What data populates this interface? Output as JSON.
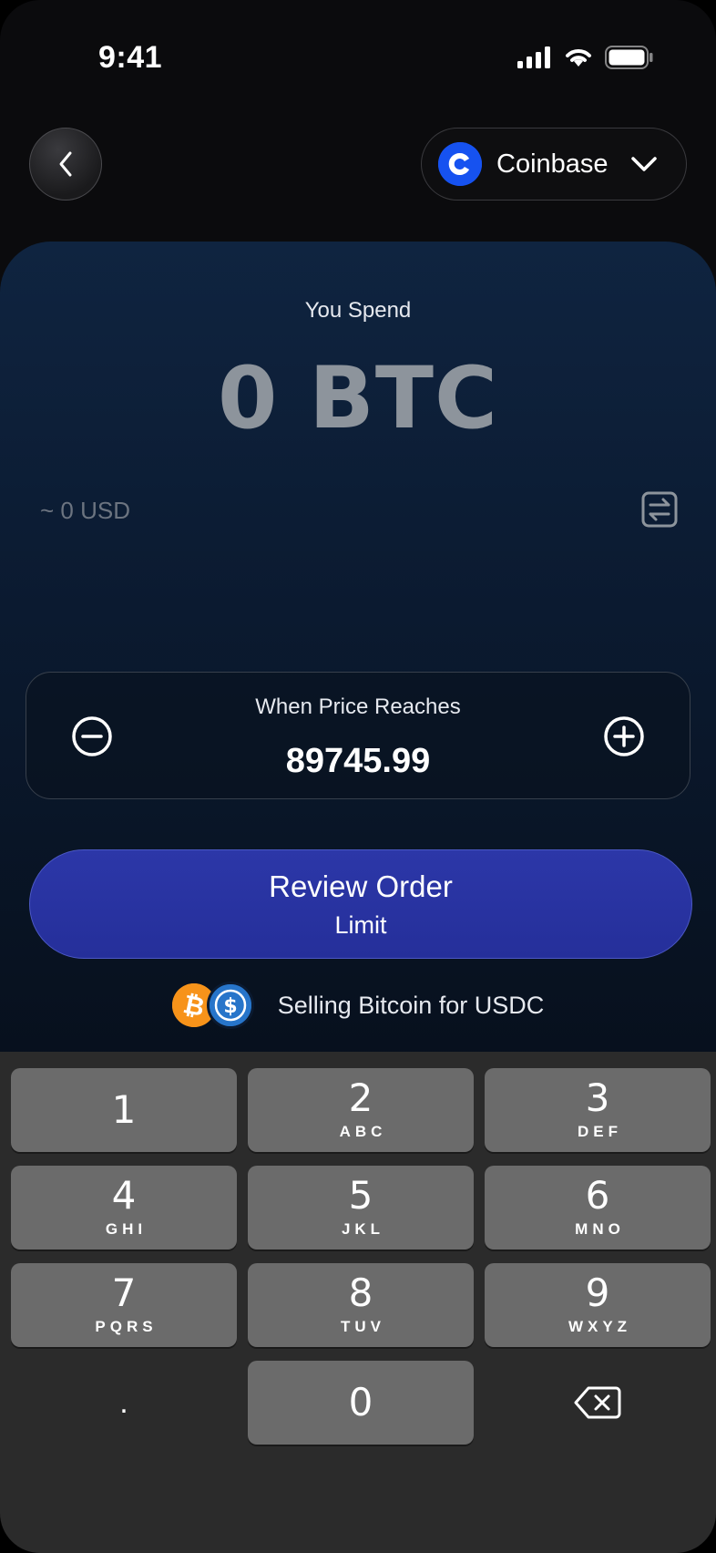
{
  "status_bar": {
    "time": "9:41"
  },
  "header": {
    "exchange": "Coinbase"
  },
  "order": {
    "spend_label": "You Spend",
    "spend_amount": "0 BTC",
    "usd_approx": "~ 0 USD",
    "price_label": "When Price Reaches",
    "price_value": "89745.99",
    "review_title": "Review Order",
    "review_subtitle": "Limit",
    "pair_text": "Selling Bitcoin for USDC"
  },
  "icons": {
    "back": "chevron-left-icon",
    "exchange_logo": "coinbase-logo",
    "dropdown": "chevron-down-icon",
    "swap": "swap-currency-icon",
    "minus": "minus-circle-icon",
    "plus": "plus-circle-icon",
    "btc": "bitcoin-icon",
    "usdc": "usdc-icon",
    "backspace": "backspace-icon"
  },
  "colors": {
    "accent": "#2c37a8",
    "coinbase_blue": "#1652f0",
    "btc_orange": "#f7931a",
    "usdc_blue": "#2775ca"
  },
  "keypad": {
    "keys": [
      {
        "num": "1",
        "letters": ""
      },
      {
        "num": "2",
        "letters": "ABC"
      },
      {
        "num": "3",
        "letters": "DEF"
      },
      {
        "num": "4",
        "letters": "GHI"
      },
      {
        "num": "5",
        "letters": "JKL"
      },
      {
        "num": "6",
        "letters": "MNO"
      },
      {
        "num": "7",
        "letters": "PQRS"
      },
      {
        "num": "8",
        "letters": "TUV"
      },
      {
        "num": "9",
        "letters": "WXYZ"
      },
      {
        "num": "0",
        "letters": ""
      }
    ],
    "decimal": "."
  }
}
